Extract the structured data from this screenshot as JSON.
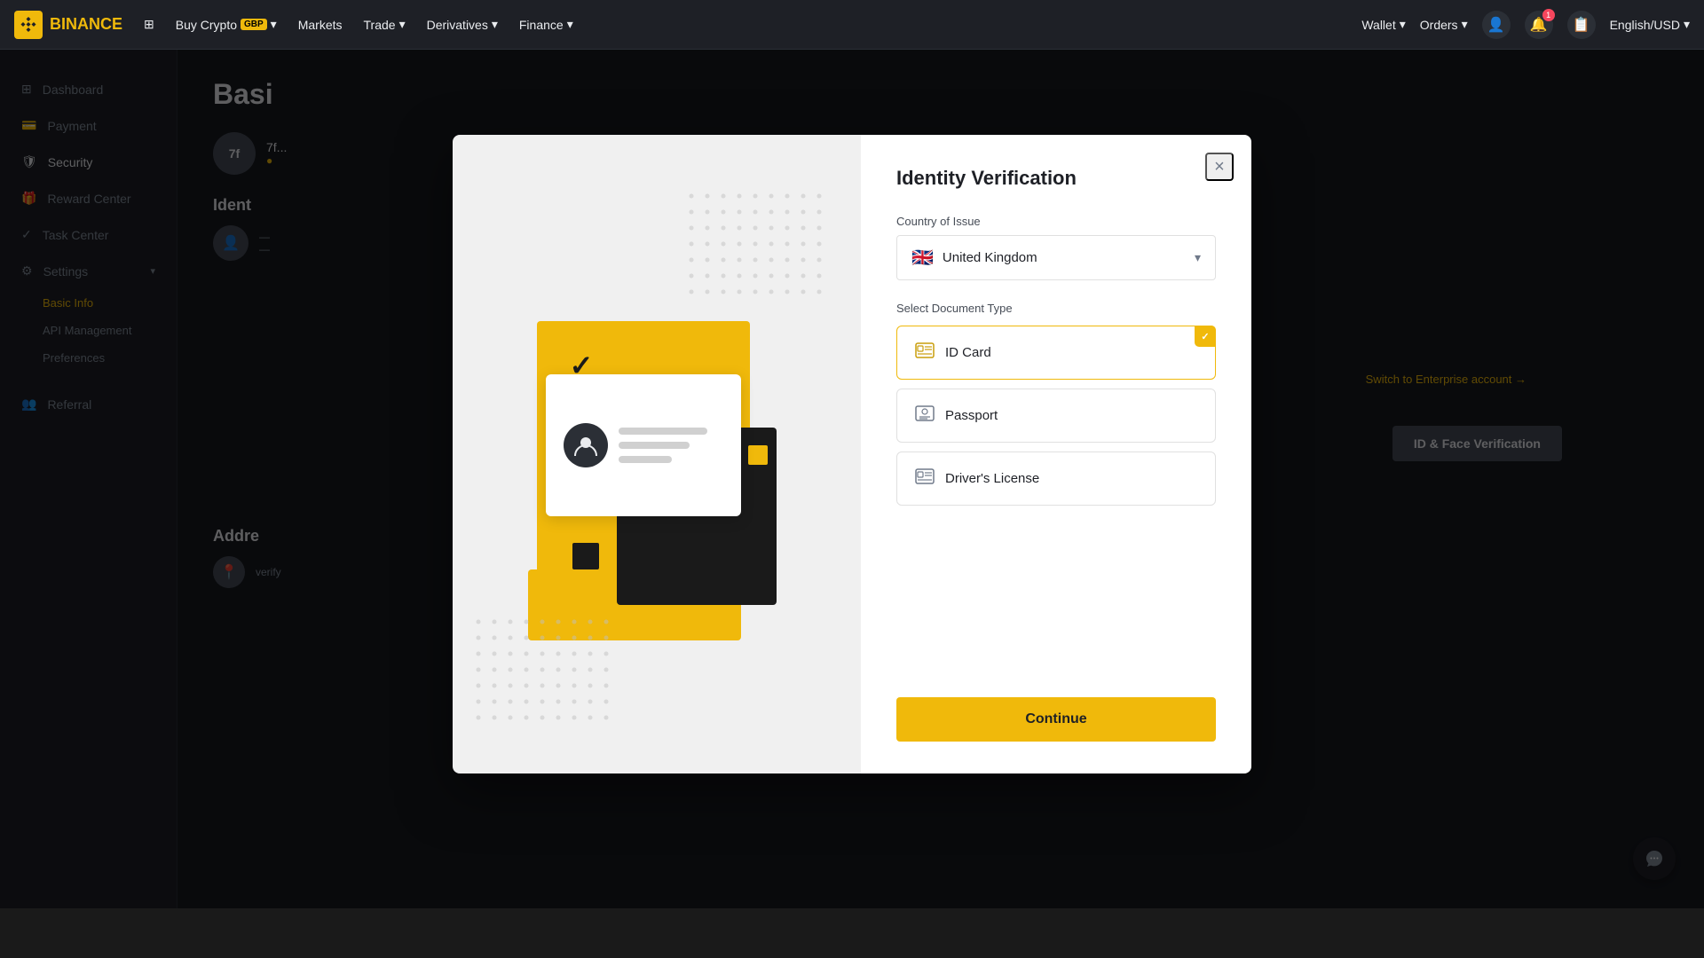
{
  "topnav": {
    "logo_text": "BINANCE",
    "menu_items": [
      {
        "label": "Buy Crypto",
        "badge": "GBP",
        "has_badge": true
      },
      {
        "label": "Markets"
      },
      {
        "label": "Trade"
      },
      {
        "label": "Derivatives"
      },
      {
        "label": "Finance"
      }
    ],
    "right_items": [
      {
        "label": "Wallet"
      },
      {
        "label": "Orders"
      }
    ],
    "language": "English/USD",
    "notification_count": "1"
  },
  "sidebar": {
    "items": [
      {
        "label": "Dashboard",
        "icon": "grid"
      },
      {
        "label": "Payment",
        "icon": "payment"
      },
      {
        "label": "Security",
        "icon": "shield"
      },
      {
        "label": "Reward Center",
        "icon": "gift"
      },
      {
        "label": "Task Center",
        "icon": "check"
      },
      {
        "label": "Settings",
        "icon": "settings",
        "expanded": true
      }
    ],
    "sub_items": [
      {
        "label": "Basic Info",
        "active": true
      },
      {
        "label": "API Management"
      },
      {
        "label": "Preferences"
      }
    ],
    "bottom_items": [
      {
        "label": "Referral",
        "icon": "referral"
      }
    ]
  },
  "main": {
    "page_title": "Basi",
    "id_section_title": "Ident",
    "address_section_title": "Addre",
    "switch_enterprise_text": "Switch to Enterprise account →",
    "verify_btn_label": "ID & Face Verification",
    "verify_label": "verify"
  },
  "modal": {
    "title": "Identity Verification",
    "close_label": "×",
    "country_label": "Country of Issue",
    "country_value": "United Kingdom",
    "country_flag": "🇬🇧",
    "doc_type_label": "Select Document Type",
    "doc_options": [
      {
        "id": "id_card",
        "label": "ID Card",
        "icon": "🪪",
        "selected": true
      },
      {
        "id": "passport",
        "label": "Passport",
        "icon": "📘",
        "selected": false
      },
      {
        "id": "drivers_license",
        "label": "Driver's License",
        "icon": "🪪",
        "selected": false
      }
    ],
    "continue_label": "Continue"
  }
}
